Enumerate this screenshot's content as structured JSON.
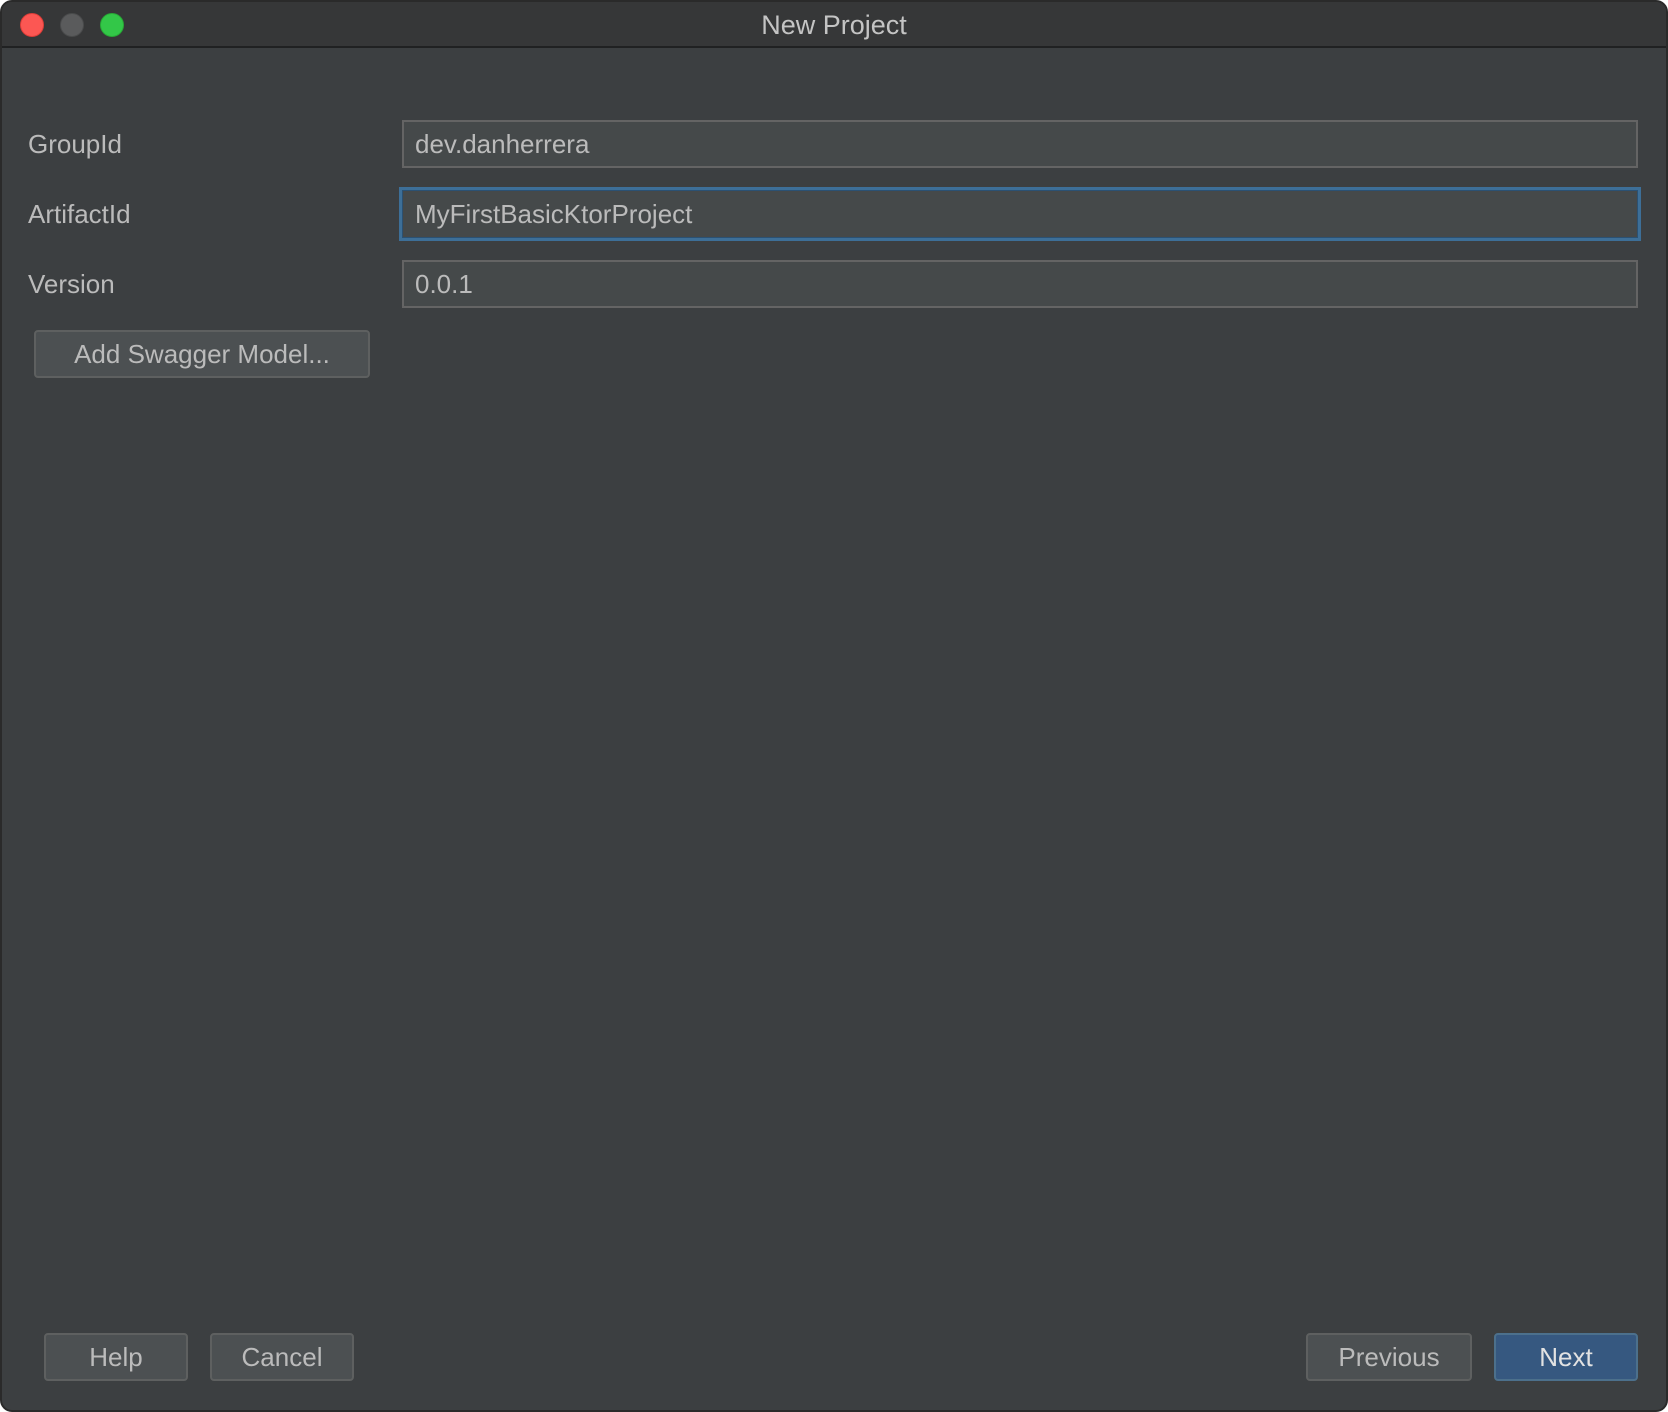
{
  "window": {
    "title": "New Project"
  },
  "form": {
    "group_id": {
      "label": "GroupId",
      "value": "dev.danherrera"
    },
    "artifact_id": {
      "label": "ArtifactId",
      "value": "MyFirstBasicKtorProject"
    },
    "version": {
      "label": "Version",
      "value": "0.0.1"
    },
    "add_swagger_label": "Add Swagger Model..."
  },
  "footer": {
    "help_label": "Help",
    "cancel_label": "Cancel",
    "previous_label": "Previous",
    "next_label": "Next"
  },
  "colors": {
    "background": "#3c3f41",
    "field_background": "#45494a",
    "focus_border": "#3d6f98",
    "primary_button": "#365880",
    "close": "#fc5753",
    "maximize": "#33c748"
  }
}
